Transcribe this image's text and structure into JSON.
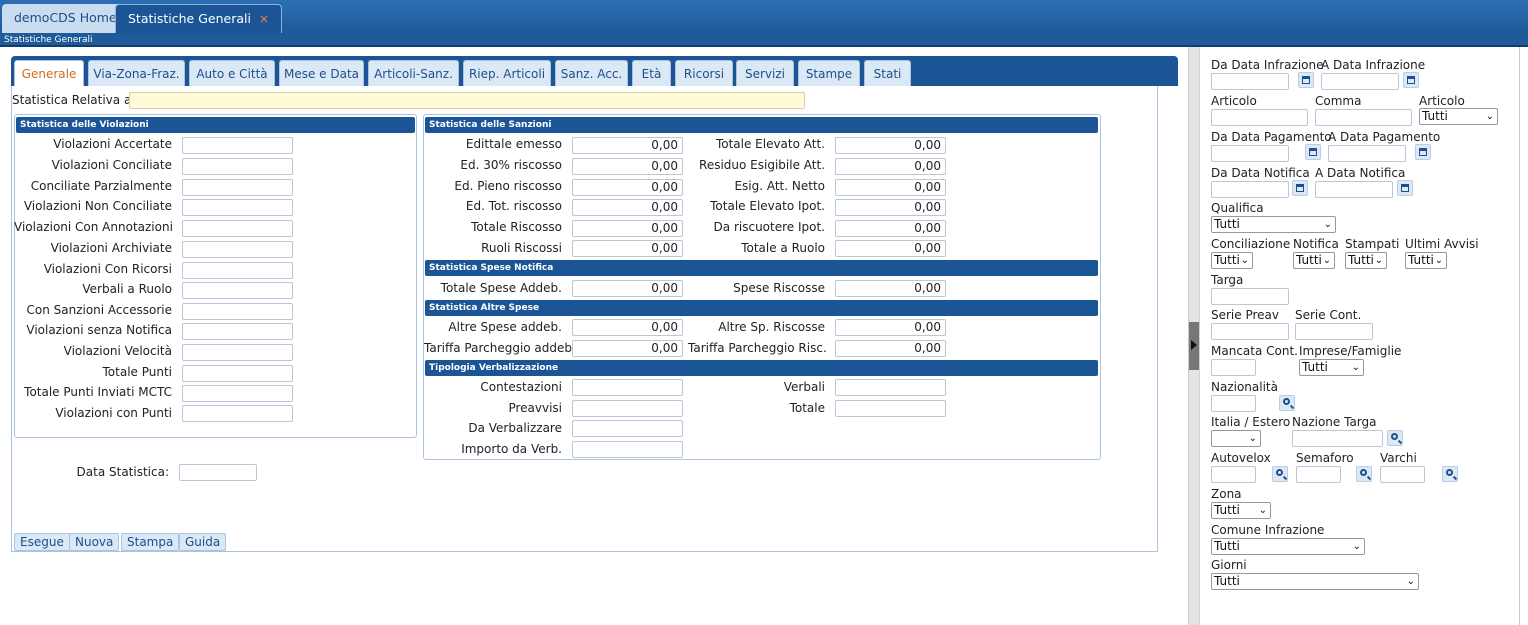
{
  "window_tabs": [
    {
      "label": "demoCDS Home"
    },
    {
      "label": "Statistiche Generali",
      "close": "×"
    }
  ],
  "breadcrumb": "Statistiche Generali",
  "inner_tabs": [
    "Generale",
    "Via-Zona-Fraz.",
    "Auto e Città",
    "Mese e Data",
    "Articoli-Sanz.",
    "Riep. Articoli",
    "Sanz. Acc.",
    "Età",
    "Ricorsi",
    "Servizi",
    "Stampe",
    "Stati"
  ],
  "statistica_relativa_label": "Statistica Relativa a :",
  "violazioni": {
    "header": "Statistica delle Violazioni",
    "labels": [
      "Violazioni Accertate",
      "Violazioni Conciliate",
      "Conciliate Parzialmente",
      "Violazioni Non Conciliate",
      "Violazioni Con Annotazioni",
      "Violazioni Archiviate",
      "Violazioni Con Ricorsi",
      "Verbali a Ruolo",
      "Con Sanzioni Accessorie",
      "Violazioni senza Notifica",
      "Violazioni Velocità",
      "Totale Punti",
      "Totale Punti Inviati MCTC",
      "Violazioni con Punti"
    ]
  },
  "sanzioni": {
    "header": "Statistica delle Sanzioni",
    "left": [
      {
        "label": "Edittale emesso",
        "value": "0,00"
      },
      {
        "label": "Ed. 30% riscosso",
        "value": "0,00"
      },
      {
        "label": "Ed. Pieno riscosso",
        "value": "0,00"
      },
      {
        "label": "Ed. Tot. riscosso",
        "value": "0,00"
      },
      {
        "label": "Totale Riscosso",
        "value": "0,00"
      },
      {
        "label": "Ruoli Riscossi",
        "value": "0,00"
      }
    ],
    "right": [
      {
        "label": "Totale Elevato Att.",
        "value": "0,00"
      },
      {
        "label": "Residuo Esigibile Att.",
        "value": "0,00"
      },
      {
        "label": "Esig. Att. Netto",
        "value": "0,00"
      },
      {
        "label": "Totale Elevato Ipot.",
        "value": "0,00"
      },
      {
        "label": "Da riscuotere Ipot.",
        "value": "0,00"
      },
      {
        "label": "Totale a Ruolo",
        "value": "0,00"
      }
    ]
  },
  "spese_notifica": {
    "header": "Statistica Spese Notifica",
    "left": {
      "label": "Totale Spese Addeb.",
      "value": "0,00"
    },
    "right": {
      "label": "Spese Riscosse",
      "value": "0,00"
    }
  },
  "altre_spese": {
    "header": "Statistica Altre Spese",
    "rows": [
      {
        "left_label": "Altre Spese addeb.",
        "left_value": "0,00",
        "right_label": "Altre Sp. Riscosse",
        "right_value": "0,00"
      },
      {
        "left_label": "Tariffa Parcheggio addeb.",
        "left_value": "0,00",
        "right_label": "Tariffa Parcheggio Risc.",
        "right_value": "0,00"
      }
    ]
  },
  "tipologia": {
    "header": "Tipologia Verbalizzazione",
    "left": [
      "Contestazioni",
      "Preavvisi",
      "Da Verbalizzare",
      "Importo da Verb."
    ],
    "right": [
      "Verbali",
      "Totale"
    ]
  },
  "data_statistica_label": "Data Statistica:",
  "buttons": [
    "Esegue",
    "Nuova",
    "Stampa",
    "Guida"
  ],
  "filters": {
    "da_data_infrazione": "Da Data Infrazione",
    "a_data_infrazione": "A Data Infrazione",
    "articolo": "Articolo",
    "comma": "Comma",
    "articolo_select_label": "Articolo",
    "articolo_select_value": "Tutti",
    "da_data_pagamento": "Da Data Pagamento",
    "a_data_pagamento": "A Data Pagamento",
    "da_data_notifica": "Da Data Notifica",
    "a_data_notifica": "A Data Notifica",
    "qualifica": "Qualifica",
    "qualifica_value": "Tutti",
    "conciliazione": "Conciliazione",
    "conciliazione_value": "Tutti",
    "notifica": "Notifica",
    "notifica_value": "Tutti",
    "stampati": "Stampati",
    "stampati_value": "Tutti",
    "ultimi_avvisi": "Ultimi Avvisi",
    "ultimi_avvisi_value": "Tutti",
    "targa": "Targa",
    "serie_preav": "Serie Preav",
    "serie_cont": "Serie Cont.",
    "mancata_cont": "Mancata Cont.",
    "imprese_famiglie": "Imprese/Famiglie",
    "imprese_famiglie_value": "Tutti",
    "nazionalita": "Nazionalità",
    "italia_estero": "Italia / Estero",
    "nazione_targa": "Nazione Targa",
    "autovelox": "Autovelox",
    "semaforo": "Semaforo",
    "varchi": "Varchi",
    "zona": "Zona",
    "zona_value": "Tutti",
    "comune_infrazione": "Comune Infrazione",
    "comune_infrazione_value": "Tutti",
    "giorni": "Giorni",
    "giorni_value": "Tutti"
  },
  "icons": {
    "calendar": "calendar-icon",
    "search": "search-icon",
    "chevron": "chevron-down-icon",
    "expand": "expand-arrow-icon"
  },
  "colors": {
    "header_blue": "#1c5596",
    "active_tab_text": "#d46a1a",
    "close_x": "#f08a33"
  }
}
